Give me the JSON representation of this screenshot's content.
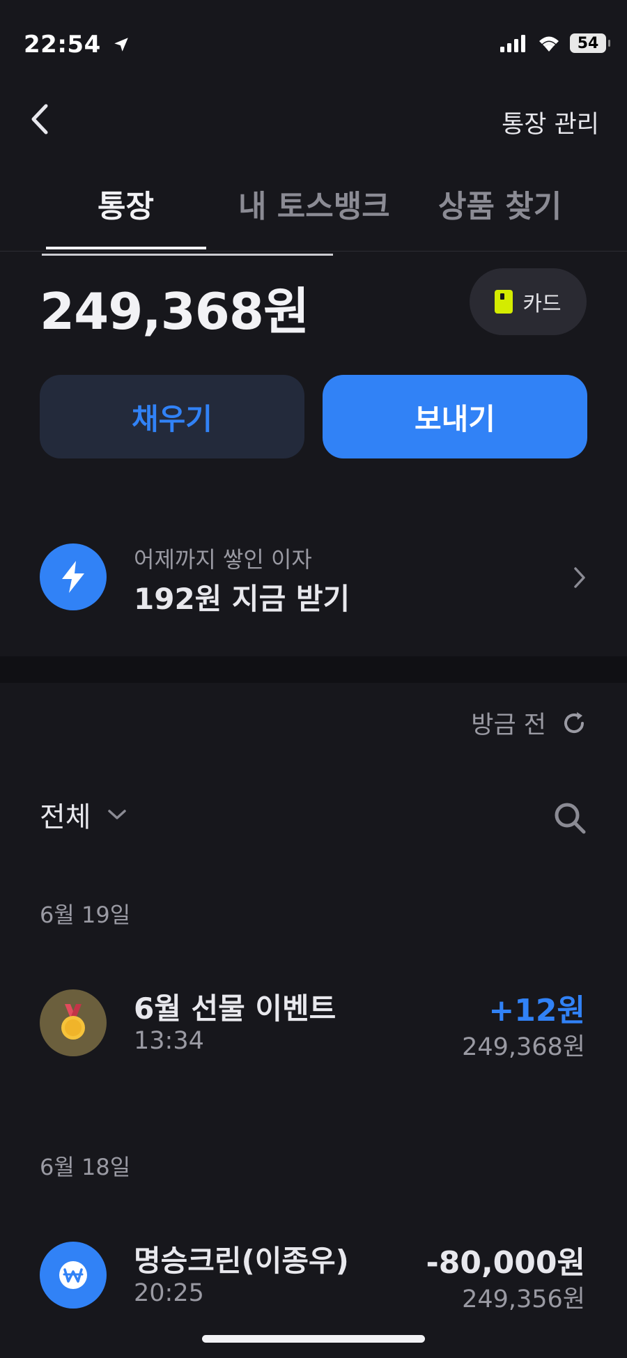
{
  "status": {
    "time": "22:54",
    "battery": "54"
  },
  "header": {
    "manage_label": "통장 관리"
  },
  "tabs": [
    {
      "label": "통장"
    },
    {
      "label": "내 토스뱅크"
    },
    {
      "label": "상품 찾기"
    }
  ],
  "account": {
    "balance": "249,368원",
    "card_label": "카드",
    "fill_label": "채우기",
    "send_label": "보내기"
  },
  "interest": {
    "subtitle": "어제까지 쌓인 이자",
    "main": "192원 지금 받기"
  },
  "history": {
    "refresh_label": "방금 전",
    "filter_label": "전체",
    "groups": [
      {
        "date": "6월 19일",
        "items": [
          {
            "name": "6월 선물 이벤트",
            "time": "13:34",
            "amount": "+12원",
            "balance": "249,368원",
            "icon": "medal-icon",
            "amount_color": "#3182f6"
          }
        ]
      },
      {
        "date": "6월 18일",
        "items": [
          {
            "name": "명승크린(이종우)",
            "time": "20:25",
            "amount": "-80,000원",
            "balance": "249,356원",
            "icon": "won-icon",
            "amount_color": "#e8e8ed"
          }
        ]
      }
    ]
  },
  "colors": {
    "accent": "#3182f6",
    "background": "#17171c",
    "card_chip": "#d4ec00"
  }
}
